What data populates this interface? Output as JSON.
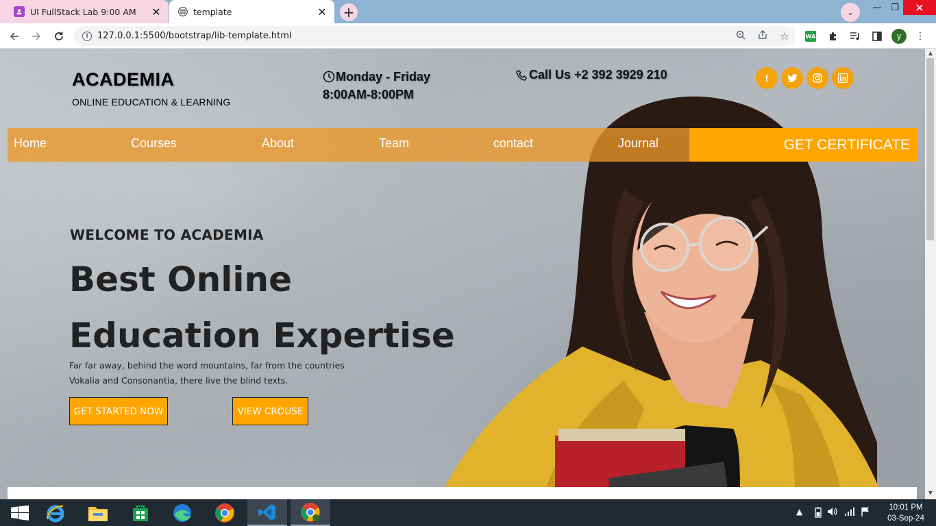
{
  "browser": {
    "tabs": [
      {
        "title": "UI FullStack Lab 9:00 AM",
        "active": false
      },
      {
        "title": "template",
        "active": true
      }
    ],
    "new_tab_label": "+",
    "profile_dropdown": "⌄",
    "window_controls": {
      "minimize": "—",
      "maximize": "❐",
      "close": "✕"
    },
    "url": "127.0.0.1:5500/bootstrap/lib-template.html",
    "avatar_letter": "y",
    "extension_wa": "WA"
  },
  "header": {
    "brand": "ACADEMIA",
    "tagline": "ONLINE EDUCATION & LEARNING",
    "hours_days": "Monday - Friday",
    "hours_time": "8:00AM-8:00PM",
    "phone": "Call Us +2 392 3929 210",
    "socials": [
      {
        "name": "facebook",
        "glyph": "f"
      },
      {
        "name": "twitter",
        "glyph": "t"
      },
      {
        "name": "instagram",
        "glyph": "◎"
      },
      {
        "name": "linkedin",
        "glyph": "in"
      }
    ]
  },
  "nav": {
    "items": [
      "Home",
      "Courses",
      "About",
      "Team",
      "contact",
      "Journal"
    ],
    "cta": "GET CERTIFICATE"
  },
  "hero": {
    "kicker": "WELCOME TO ACADEMIA",
    "title": "Best Online Education Expertise",
    "lead_line1": "Far far away, behind the word mountains, far from the countries",
    "lead_line2": "Vokalia and Consonantia, there live the blind texts.",
    "primary_button": "GET STARTED NOW",
    "secondary_button": "VIEW CROUSE"
  },
  "taskbar": {
    "apps": [
      "windows-start",
      "internet-explorer",
      "file-explorer",
      "microsoft-store",
      "edge",
      "chrome",
      "vscode",
      "chrome-profile"
    ],
    "time": "10:01 PM",
    "date": "03-Sep-24"
  },
  "colors": {
    "accent": "#ffa500",
    "nav_bg": "#ec9728",
    "text_dark": "#222222"
  }
}
